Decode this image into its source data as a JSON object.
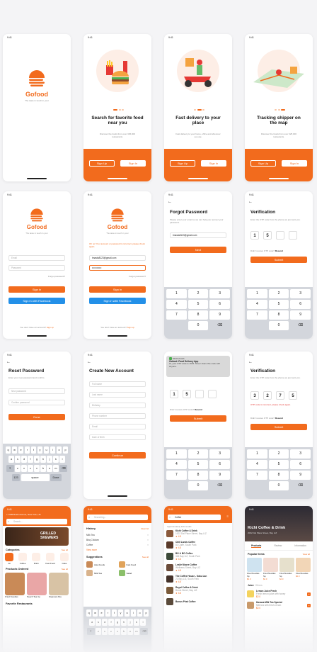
{
  "status_time": "9:41",
  "brand": {
    "name": "Gofood",
    "tagline": "The taste in touch in your",
    "accent": "#f26b1d",
    "facebook_blue": "#2390e8"
  },
  "onboarding": [
    {
      "title": "Search for favorite food near you",
      "desc": "Discover the foods from over 325,000 restaurants."
    },
    {
      "title": "Fast delivery to your place",
      "desc": "Fast delivery to your home, office and wherever you are."
    },
    {
      "title": "Tracking shipper on the map",
      "desc": "Discover the foods from over 325,000 restaurants."
    }
  ],
  "buttons": {
    "sign_up": "Sign Up",
    "sign_in": "Sign In",
    "sign_in_lower": "Sign in",
    "sign_in_facebook": "Sign in with Facebook",
    "next": "Next",
    "submit": "Submit",
    "done": "Done",
    "continue": "Continue"
  },
  "login": {
    "email_placeholder": "Email",
    "password_placeholder": "Password",
    "forgot": "Forgot password?",
    "no_account": "You don't have an account? ",
    "sign_up_link": "Sign up",
    "error": "Oh no! Your account or password is incorrect, please check again.",
    "email_value": "tmasta8123@gmail.com",
    "password_value": "••••••••••••"
  },
  "forgot": {
    "title": "Forgot Password",
    "desc": "Please enter your email so we can help you recover your password.",
    "email_value": "tmasta8123@gmail.com"
  },
  "verification": {
    "title": "Verification",
    "desc": "Enter the OTP code from the phone we just sent you.",
    "digits_a": [
      "1",
      "5",
      "",
      ""
    ],
    "digits_b": [
      "1",
      "5",
      "",
      ""
    ],
    "digits_c": [
      "3",
      "2",
      "7",
      "5"
    ],
    "resend": "Didn't receive OTP code? ",
    "resend_link": "Resend",
    "error": "OTP code is incorrect, please check again."
  },
  "keypad": [
    "1",
    "2",
    "3",
    "4",
    "5",
    "6",
    "7",
    "8",
    "9",
    "",
    "0",
    "⌫"
  ],
  "keypad_letters": [
    "",
    "ABC",
    "DEF",
    "GHI",
    "JKL",
    "MNO",
    "PQRS",
    "TUV",
    "WXYZ",
    "",
    "",
    ""
  ],
  "reset": {
    "title": "Reset Password",
    "desc": "Enter your new password and confirm.",
    "new_pw": "New password",
    "confirm_pw": "Confirm password"
  },
  "create": {
    "title": "Create New Account",
    "fields": [
      "Full name",
      "Last name",
      "Birthday",
      "Phone number",
      "Email",
      "Date of Birth"
    ]
  },
  "notification": {
    "app": "MESSAGES",
    "sender": "Gofood: Food Delivery App",
    "text": "Hi, your OTP code is 1515. Never share this code with anyone."
  },
  "qwerty": [
    [
      "q",
      "w",
      "e",
      "r",
      "t",
      "y",
      "u",
      "i",
      "o",
      "p"
    ],
    [
      "a",
      "s",
      "d",
      "f",
      "g",
      "h",
      "j",
      "k",
      "l"
    ],
    [
      "z",
      "x",
      "c",
      "v",
      "b",
      "n",
      "m"
    ]
  ],
  "keys": {
    "space": "space",
    "done": "Done",
    "shift": "⇧",
    "del": "⌫",
    "numbers": "123"
  },
  "home": {
    "location": "7505 Bushi Avenue, New York, US",
    "search": "Search...",
    "banner_line1": "GRILLED",
    "banner_line2": "SKEWERS",
    "categories_title": "Categories",
    "see_all": "See all",
    "categories": [
      "All",
      "Coffee",
      "Drink",
      "Fast Food",
      "Cake"
    ],
    "products_title": "Products Ordered",
    "products": [
      "Fried Noodles",
      "Peach Tea Up",
      "Steamed Abu"
    ],
    "favorite": "Favorite Restaurants"
  },
  "search_history": {
    "search": "Searching...",
    "history_title": "History",
    "clear": "Clear All",
    "history": [
      "Milk Tea",
      "Bbq Chicken",
      "Coffee"
    ],
    "view_more": "View more",
    "suggestions_title": "Suggestions",
    "suggestions": [
      "Asia Foods",
      "Fast Food",
      "Milk Tea",
      "Salad"
    ]
  },
  "results": {
    "query": "Coffee",
    "count": "Approximately 126 results",
    "items": [
      {
        "name": "Kichi Coffee & Drink",
        "addr": "1002 Dal Place Street, Bay LIZ",
        "rating": "4.5"
      },
      {
        "name": "Chill Lands Coffee",
        "addr": "81 Caffe, South Park",
        "rating": "4.5"
      },
      {
        "name": "BG & BO Coffee",
        "addr": "345 Bay LIZ, South Park",
        "rating": "4.5"
      },
      {
        "name": "Leslie Moore Coffee",
        "addr": "Wellness Street, Bay LIZ",
        "rating": "4.5"
      },
      {
        "name": "The Coffee House - Kaku Lan",
        "addr": "21 Bay LIZ, South Park",
        "rating": "4.5"
      },
      {
        "name": "Royal Coffee & Drink",
        "addr": "Brook Street, Bay LIZ",
        "rating": "4.5"
      },
      {
        "name": "Bonus Phat Coffee",
        "addr": "",
        "rating": ""
      }
    ]
  },
  "restaurant": {
    "name": "Kichi Coffee & Drink",
    "addr": "2002 Dal Place Street, Bay LIZ",
    "tabs": [
      "Products",
      "Review",
      "Information"
    ],
    "popular": "Popular Items",
    "view_all": "View all",
    "popular_items": [
      {
        "name": "Fried Noodles Sp",
        "price": "$2.0"
      },
      {
        "name": "Fried Noodles Sp",
        "price": "$2.0"
      },
      {
        "name": "Fried Noodles Sp",
        "price": "$2.0"
      },
      {
        "name": "Fried Noodles",
        "price": "$2.0"
      }
    ],
    "juice_label": "Juice",
    "juice_tab": "Others",
    "juice_items": [
      {
        "name": "Lemon Juice Fresh",
        "desc": "Fresh lemon juice with honey",
        "price": "$2.0"
      },
      {
        "name": "Havana Milk Tea Special",
        "desc": "Milk tea with fresh cream",
        "price": "$2.0"
      }
    ]
  }
}
